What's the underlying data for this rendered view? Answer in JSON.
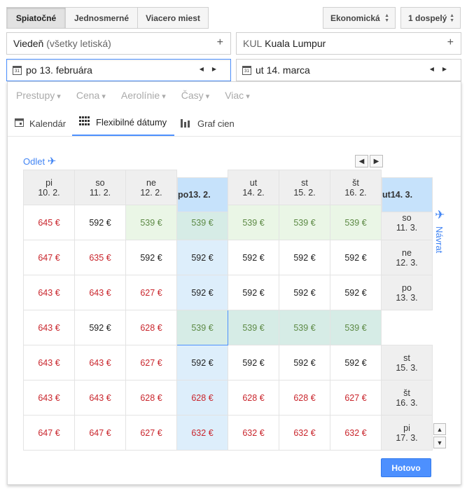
{
  "trip_types": [
    "Spiatočné",
    "Jednosmerné",
    "Viacero miest"
  ],
  "cabin": "Ekonomická",
  "passengers": "1 dospelý",
  "from": {
    "code_or_name": "Viedeň",
    "suffix": "(všetky letiská)"
  },
  "to": {
    "code": "KUL",
    "name": "Kuala Lumpur"
  },
  "depart_date": "po 13. februára",
  "return_date": "ut 14. marca",
  "filters": [
    "Prestupy",
    "Cena",
    "Aerolínie",
    "Časy",
    "Viac"
  ],
  "tabs": {
    "calendar": "Kalendár",
    "flexible": "Flexibilné dátumy",
    "chart": "Graf cien"
  },
  "calendar_icon_text": "31",
  "odlet_label": "Odlet",
  "navrat_label": "Návrat",
  "done_label": "Hotovo",
  "columns": [
    {
      "day": "pi",
      "date": "10. 2."
    },
    {
      "day": "so",
      "date": "11. 2."
    },
    {
      "day": "ne",
      "date": "12. 2."
    },
    {
      "day": "po",
      "date": "13. 2."
    },
    {
      "day": "ut",
      "date": "14. 2."
    },
    {
      "day": "st",
      "date": "15. 2."
    },
    {
      "day": "št",
      "date": "16. 2."
    }
  ],
  "rows": [
    {
      "day": "so",
      "date": "11. 3.",
      "prices": [
        "645 €",
        "592 €",
        "539 €",
        "539 €",
        "539 €",
        "539 €",
        "539 €"
      ]
    },
    {
      "day": "ne",
      "date": "12. 3.",
      "prices": [
        "647 €",
        "635 €",
        "592 €",
        "592 €",
        "592 €",
        "592 €",
        "592 €"
      ]
    },
    {
      "day": "po",
      "date": "13. 3.",
      "prices": [
        "643 €",
        "643 €",
        "627 €",
        "592 €",
        "592 €",
        "592 €",
        "592 €"
      ]
    },
    {
      "day": "ut",
      "date": "14. 3.",
      "prices": [
        "643 €",
        "592 €",
        "628 €",
        "539 €",
        "539 €",
        "539 €",
        "539 €"
      ]
    },
    {
      "day": "st",
      "date": "15. 3.",
      "prices": [
        "643 €",
        "643 €",
        "627 €",
        "592 €",
        "592 €",
        "592 €",
        "592 €"
      ]
    },
    {
      "day": "št",
      "date": "16. 3.",
      "prices": [
        "643 €",
        "643 €",
        "628 €",
        "628 €",
        "628 €",
        "628 €",
        "627 €"
      ]
    },
    {
      "day": "pi",
      "date": "17. 3.",
      "prices": [
        "647 €",
        "647 €",
        "627 €",
        "632 €",
        "632 €",
        "632 €",
        "632 €"
      ]
    }
  ],
  "colors": {
    "accent": "#4d90fe",
    "high_price": "#c9252c",
    "low_price": "#5d8a45"
  }
}
